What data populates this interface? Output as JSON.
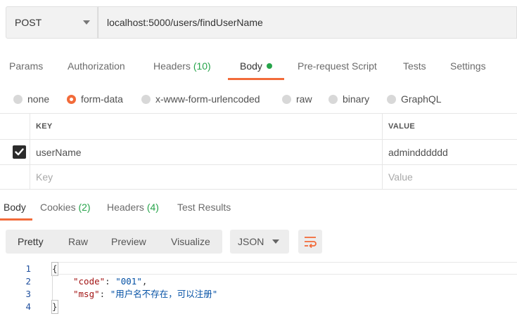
{
  "request": {
    "method": "POST",
    "url": "localhost:5000/users/findUserName"
  },
  "request_tabs": [
    {
      "label": "Params"
    },
    {
      "label": "Authorization"
    },
    {
      "label": "Headers",
      "count": "(10)"
    },
    {
      "label": "Body",
      "active": true
    },
    {
      "label": "Pre-request Script"
    },
    {
      "label": "Tests"
    },
    {
      "label": "Settings"
    }
  ],
  "body_types": [
    {
      "label": "none"
    },
    {
      "label": "form-data",
      "checked": true
    },
    {
      "label": "x-www-form-urlencoded"
    },
    {
      "label": "raw"
    },
    {
      "label": "binary"
    },
    {
      "label": "GraphQL"
    }
  ],
  "params_table": {
    "headers": [
      "KEY",
      "VALUE"
    ],
    "rows": [
      {
        "checked": true,
        "key": "userName",
        "value": "admindddddd"
      }
    ],
    "placeholder": {
      "key": "Key",
      "value": "Value"
    }
  },
  "response_tabs": [
    {
      "label": "Body",
      "active": true
    },
    {
      "label": "Cookies",
      "count": "(2)"
    },
    {
      "label": "Headers",
      "count": "(4)"
    },
    {
      "label": "Test Results"
    }
  ],
  "view_modes": [
    "Pretty",
    "Raw",
    "Preview",
    "Visualize"
  ],
  "active_view": "Pretty",
  "format": "JSON",
  "code": {
    "line_numbers": [
      "1",
      "2",
      "3",
      "4"
    ],
    "open_brace": "{",
    "close_brace": "}",
    "entries": [
      {
        "key": "\"code\"",
        "value": "\"001\"",
        "trail": ","
      },
      {
        "key": "\"msg\"",
        "value": "\"用户名不存在，可以注册\"",
        "trail": ""
      }
    ]
  },
  "colors": {
    "accent": "#f26b3a",
    "success": "#26a44a",
    "line_number": "#1f4f9e",
    "json_key": "#a31515",
    "json_string": "#0451a5"
  },
  "icons": {
    "method_dropdown": "chevron-down-icon",
    "checkbox": "checkmark-icon",
    "format_dropdown": "chevron-down-icon",
    "wrap_lines": "wrap-lines-icon"
  }
}
